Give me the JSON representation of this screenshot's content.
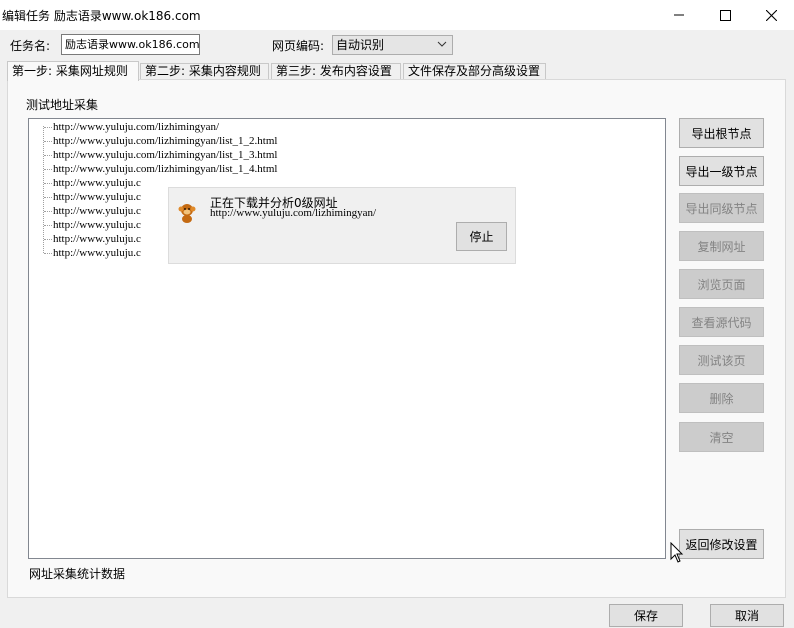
{
  "window": {
    "title": "编辑任务 励志语录www.ok186.com",
    "minimize_icon": "minimize-icon",
    "maximize_icon": "maximize-icon",
    "close_icon": "close-icon"
  },
  "form": {
    "task_name_label": "任务名:",
    "task_name_value": "励志语录www.ok186.com",
    "encoding_label": "网页编码:",
    "encoding_value": "自动识别"
  },
  "tabs": [
    {
      "label": "第一步: 采集网址规则",
      "active": true
    },
    {
      "label": "第二步: 采集内容规则",
      "active": false
    },
    {
      "label": "第三步: 发布内容设置",
      "active": false
    },
    {
      "label": "文件保存及部分高级设置",
      "active": false
    }
  ],
  "section": {
    "test_title": "测试地址采集",
    "stats_label": "网址采集统计数据"
  },
  "tree": {
    "items": [
      "http://www.yuluju.com/lizhimingyan/",
      "http://www.yuluju.com/lizhimingyan/list_1_2.html",
      "http://www.yuluju.com/lizhimingyan/list_1_3.html",
      "http://www.yuluju.com/lizhimingyan/list_1_4.html",
      "http://www.yuluju.c",
      "http://www.yuluju.c",
      "http://www.yuluju.c",
      "http://www.yuluju.c",
      "http://www.yuluju.c",
      "http://www.yuluju.c"
    ]
  },
  "side_buttons": [
    {
      "label": "导出根节点",
      "enabled": true
    },
    {
      "label": "导出一级节点",
      "enabled": true
    },
    {
      "label": "导出同级节点",
      "enabled": false
    },
    {
      "label": "复制网址",
      "enabled": false
    },
    {
      "label": "浏览页面",
      "enabled": false
    },
    {
      "label": "查看源代码",
      "enabled": false
    },
    {
      "label": "测试该页",
      "enabled": false
    },
    {
      "label": "删除",
      "enabled": false
    },
    {
      "label": "清空",
      "enabled": false
    }
  ],
  "return_button": "返回修改设置",
  "popup": {
    "status": "正在下载并分析0级网址",
    "url": "http://www.yuluju.com/lizhimingyan/",
    "stop_label": "停止",
    "icon": "monkey-icon"
  },
  "footer": {
    "save_label": "保存",
    "cancel_label": "取消"
  },
  "colors": {
    "panel_bg": "#f9f9f9",
    "window_bg": "#f0f0f0",
    "disabled_button": "#cccccc",
    "enabled_button": "#e1e1e1"
  }
}
